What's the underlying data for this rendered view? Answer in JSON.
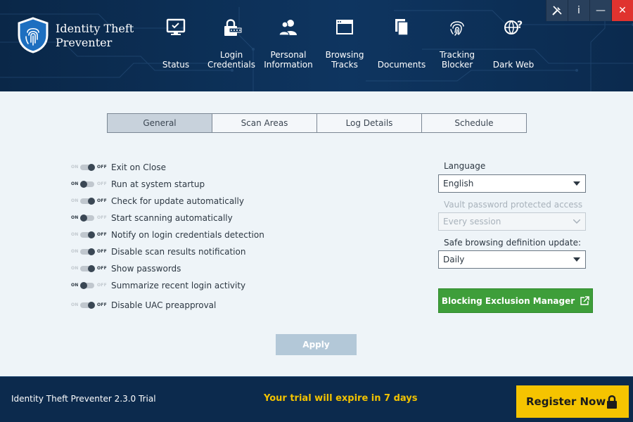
{
  "app": {
    "name_line1": "Identity Theft",
    "name_line2": "Preventer"
  },
  "nav": [
    {
      "label": "Status",
      "icon": "monitor-icon"
    },
    {
      "label": "Login\nCredentials",
      "icon": "password-lock-icon"
    },
    {
      "label": "Personal\nInformation",
      "icon": "users-icon"
    },
    {
      "label": "Browsing\nTracks",
      "icon": "browser-window-icon"
    },
    {
      "label": "Documents",
      "icon": "documents-icon"
    },
    {
      "label": "Tracking\nBlocker",
      "icon": "fingerprint-icon"
    },
    {
      "label": "Dark Web",
      "icon": "globe-question-icon"
    }
  ],
  "window_controls": {
    "info": "i",
    "minimize": "—",
    "close": "✕"
  },
  "tabs": [
    {
      "label": "General",
      "active": true
    },
    {
      "label": "Scan Areas",
      "active": false
    },
    {
      "label": "Log Details",
      "active": false
    },
    {
      "label": "Schedule",
      "active": false
    }
  ],
  "toggle_text": {
    "on": "ON",
    "off": "OFF"
  },
  "options": [
    {
      "label": "Exit on Close",
      "state": "off"
    },
    {
      "label": "Run at system startup",
      "state": "on"
    },
    {
      "label": "Check for update automatically",
      "state": "off"
    },
    {
      "label": "Start scanning automatically",
      "state": "on"
    },
    {
      "label": "Notify on login credentials detection",
      "state": "off"
    },
    {
      "label": "Disable scan results notification",
      "state": "off"
    },
    {
      "label": "Show passwords",
      "state": "off"
    },
    {
      "label": "Summarize recent login activity",
      "state": "on"
    },
    {
      "label": "Disable UAC preapproval",
      "state": "off"
    }
  ],
  "language": {
    "label": "Language",
    "value": "English"
  },
  "vault": {
    "label": "Vault password protected access",
    "value": "Every session"
  },
  "safe_browsing": {
    "label": "Safe browsing definition update:",
    "value": "Daily"
  },
  "blocking_button": "Blocking Exclusion Manager",
  "apply_button": "Apply",
  "footer": {
    "version": "Identity Theft Preventer 2.3.0 Trial",
    "trial_message": "Your trial will expire in 7 days",
    "register_button": "Register Now"
  },
  "colors": {
    "header_bg": "#0e3560",
    "content_bg": "#eef4f8",
    "green": "#3e9e3a",
    "register_yellow": "#f5c400",
    "trial_text": "#f2c200",
    "close_red": "#e0332f"
  }
}
